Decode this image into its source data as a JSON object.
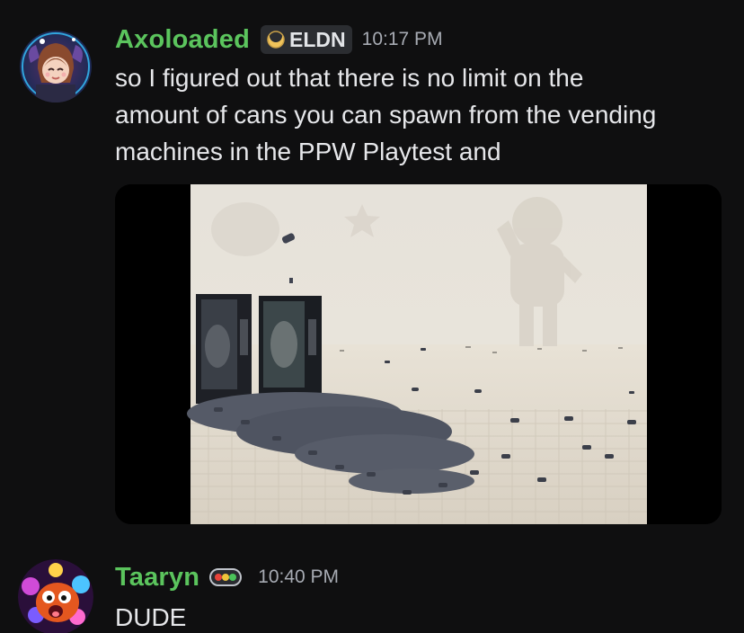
{
  "messages": [
    {
      "author": "Axoloaded",
      "tag": "ELDN",
      "timestamp": "10:17 PM",
      "text": "so I figured out that there is no limit on the\namount of cans you can spawn from the vending\nmachines in the PPW Playtest and",
      "attachment": {
        "kind": "image",
        "subject": "vending-machines-with-pile-of-cans"
      },
      "avatar_icon": "anime-avatar-icon"
    },
    {
      "author": "Taaryn",
      "timestamp": "10:40 PM",
      "text": "DUDE",
      "status_icon": "traffic-light-badge-icon",
      "avatar_icon": "cartoon-creature-avatar-icon"
    }
  ],
  "colors": {
    "background": "#0f0f10",
    "username": "#5bc45d",
    "text": "#e6e7ea",
    "timestamp": "#a7abb3",
    "tag_bg": "#2b2d31"
  }
}
